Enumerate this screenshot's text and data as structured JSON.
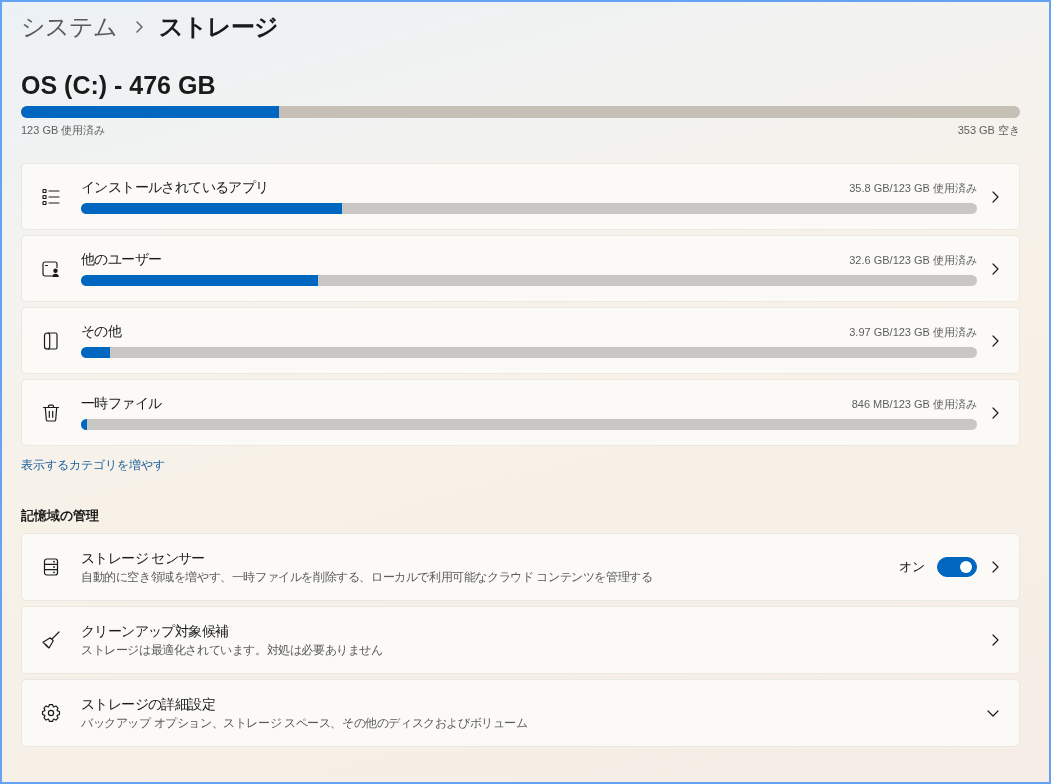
{
  "breadcrumb": {
    "parent": "システム",
    "current": "ストレージ"
  },
  "drive": {
    "title": "OS (C:) - 476 GB",
    "level": 0.258,
    "used": "123 GB 使用済み",
    "free": "353 GB 空き"
  },
  "categories": [
    {
      "label": "インストールされているアプリ",
      "usage": "35.8 GB/123 GB 使用済み",
      "level": 0.291
    },
    {
      "label": "他のユーザー",
      "usage": "32.6 GB/123 GB 使用済み",
      "level": 0.265
    },
    {
      "label": "その他",
      "usage": "3.97 GB/123 GB 使用済み",
      "level": 0.032
    },
    {
      "label": "一時ファイル",
      "usage": "846 MB/123 GB 使用済み",
      "level": 0.007
    }
  ],
  "more_categories_link": "表示するカテゴリを増やす",
  "storage_management": {
    "title": "記憶域の管理",
    "items": [
      {
        "kind": "toggle",
        "title": "ストレージ センサー",
        "description": "自動的に空き領域を増やす、一時ファイルを削除する、ローカルで利用可能なクラウド コンテンツを管理する",
        "toggle": {
          "label": "オン",
          "on": true
        }
      },
      {
        "kind": "link",
        "title": "クリーンアップ対象候補",
        "description": "ストレージは最適化されています。対処は必要ありません"
      },
      {
        "kind": "expander",
        "title": "ストレージの詳細設定",
        "description": "バックアップ オプション、ストレージ スペース、その他のディスクおよびボリューム"
      }
    ]
  }
}
